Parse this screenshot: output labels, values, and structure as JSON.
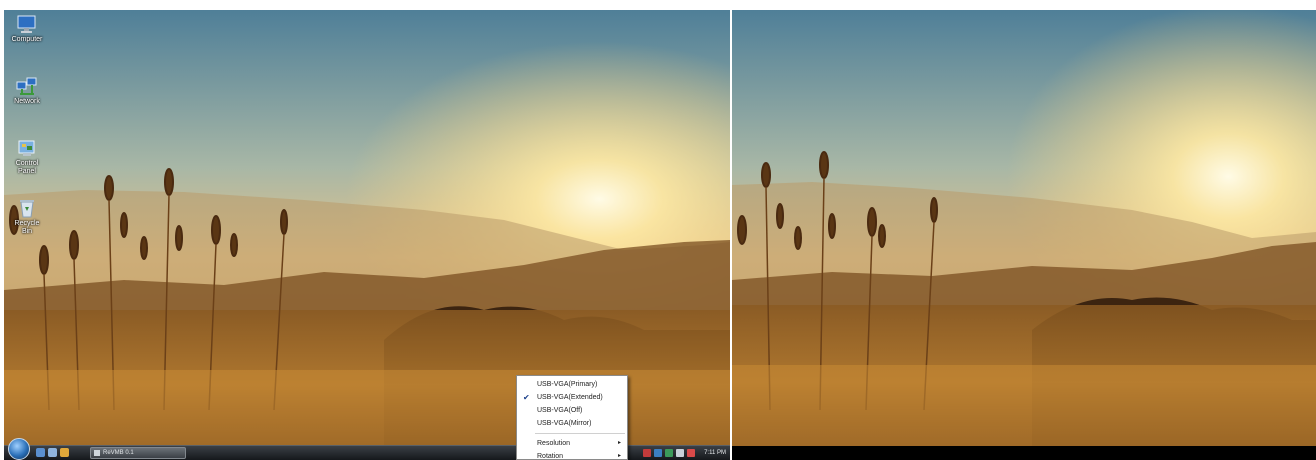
{
  "desktop": {
    "icons": [
      {
        "label": "Computer",
        "icon": "computer-icon"
      },
      {
        "label": "Network",
        "icon": "network-icon"
      },
      {
        "label": "Control Panel",
        "icon": "control-panel-icon"
      },
      {
        "label": "Recycle Bin",
        "icon": "recycle-bin-icon"
      }
    ]
  },
  "taskbar": {
    "task_button_label": "ReVMB 0.1",
    "clock": "7:11 PM"
  },
  "context_menu": {
    "items": [
      {
        "label": "USB-VGA(Primary)",
        "checked": false
      },
      {
        "label": "USB-VGA(Extended)",
        "checked": true
      },
      {
        "label": "USB-VGA(Off)",
        "checked": false
      },
      {
        "label": "USB-VGA(Mirror)",
        "checked": false
      }
    ],
    "submenus": [
      {
        "label": "Resolution",
        "arrow": "▸"
      },
      {
        "label": "Rotation",
        "arrow": "▸"
      }
    ],
    "check_glyph": "✔"
  },
  "colors": {
    "sky_top": "#5f8fa6",
    "sun_glow": "#ffe7a0",
    "ground": "#6a3c14",
    "taskbar": "#23272b"
  }
}
